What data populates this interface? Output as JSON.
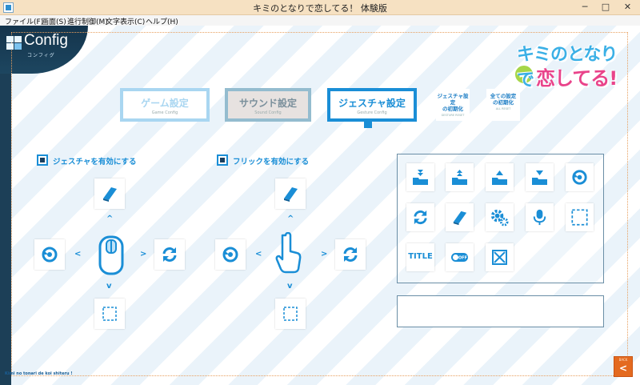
{
  "window": {
    "title": "キミのとなりで恋してる！ 体験版",
    "minimize": "─",
    "maximize": "□",
    "close": "✕"
  },
  "menu": [
    "ファイル(F)",
    "画面(S)",
    "進行制御(M)",
    "文字表示(C)",
    "ヘルプ(H)"
  ],
  "brand": {
    "title": "Config",
    "subtitle": "コンフィグ"
  },
  "logo": {
    "line1": "キミのとなりで",
    "line2": "恋してる!"
  },
  "tabs": [
    {
      "label": "ゲーム設定",
      "sub": "Game Config",
      "state": "inactive"
    },
    {
      "label": "サウンド設定",
      "sub": "Sound Config",
      "state": "inactive"
    },
    {
      "label": "ジェスチャ設定",
      "sub": "Gesture Config",
      "state": "active"
    }
  ],
  "resets": [
    {
      "label1": "ジェスチャ設定",
      "label2": "の初期化",
      "sub": "GESTURE RESET"
    },
    {
      "label1": "全ての設定",
      "label2": "の初期化",
      "sub": "ALL RESET"
    }
  ],
  "options": {
    "gesture": {
      "label": "ジェスチャを有効にする",
      "checked": true
    },
    "flick": {
      "label": "フリックを有効にする",
      "checked": true
    }
  },
  "gesture_pad": {
    "center": "mouse-icon",
    "up": "book-icon",
    "left": "rewind-icon",
    "right": "refresh-icon",
    "down": "empty-slot"
  },
  "flick_pad": {
    "center": "hand-pointer-icon",
    "up": "book-icon",
    "left": "rewind-icon",
    "right": "refresh-icon",
    "down": "empty-slot"
  },
  "chevrons": {
    "up": "^",
    "down": "v",
    "left": "<",
    "right": ">"
  },
  "palette": {
    "rows": [
      [
        "quick-save-icon",
        "quick-load-icon",
        "save-icon",
        "load-icon",
        "rewind-icon"
      ],
      [
        "refresh-icon",
        "book-icon",
        "settings-icon",
        "voice-icon",
        "empty-slot"
      ],
      [
        "title-button",
        "toggle-off-icon",
        "close-window-icon"
      ]
    ],
    "title_text": "TITLE",
    "toggle_text": "OFF"
  },
  "footer": {
    "text": "Kimi no tonari de koi shiteru !"
  },
  "back": {
    "label": "BACK",
    "arrow": "<"
  },
  "colors": {
    "accent": "#1a8ed6",
    "dark": "#14344c",
    "back": "#e46a1f"
  }
}
